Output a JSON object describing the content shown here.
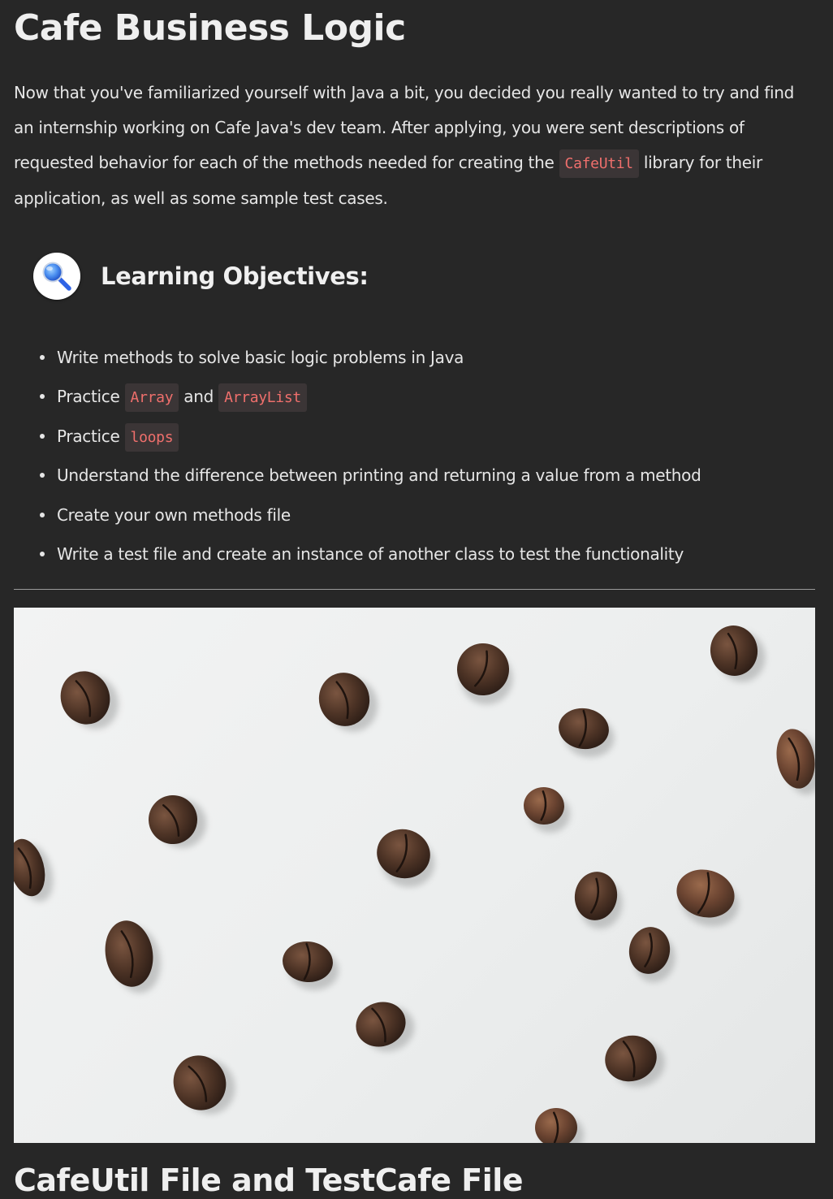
{
  "page": {
    "title": "Cafe Business Logic",
    "section_title": "CafeUtil File and TestCafe File"
  },
  "intro": {
    "text_before_code": "Now that you've familiarized yourself with Java a bit, you decided you really wanted to try and find an internship working on Cafe Java's dev team. After applying, you were sent descriptions of requested behavior for each of the methods needed for creating the ",
    "code": "CafeUtil",
    "text_after_code": " library for their application, as well as some sample test cases."
  },
  "objectives": {
    "icon": "magnifying-glass-icon",
    "title": "Learning Objectives:",
    "items": [
      {
        "text": "Write methods to solve basic logic problems in Java"
      },
      {
        "pre": "Practice ",
        "code1": "Array",
        "mid": " and ",
        "code2": "ArrayList"
      },
      {
        "pre": "Practice ",
        "code1": "loops"
      },
      {
        "text": "Understand the difference between printing and returning a value from a method"
      },
      {
        "text": "Create your own methods file"
      },
      {
        "text": "Write a test file and create an instance of another class to test the functionality"
      }
    ]
  },
  "image": {
    "subject": "coffee beans scattered on a white surface"
  },
  "colors": {
    "background": "#272727",
    "text": "#e6e6e6",
    "code_text": "#ef6f6c",
    "code_background": "#3b3536",
    "icon_accent": "#2f63e6"
  }
}
